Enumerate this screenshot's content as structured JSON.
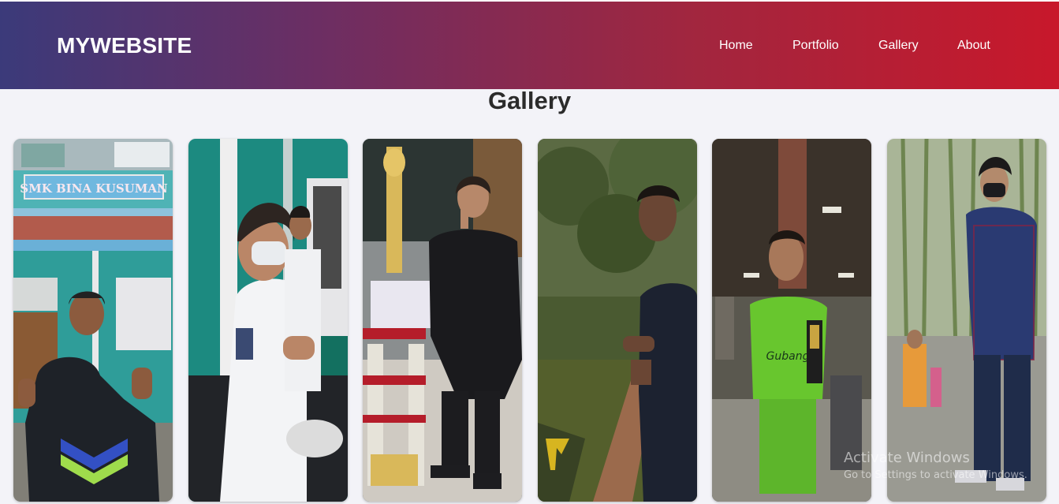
{
  "header": {
    "brand": "MYWEBSITE",
    "nav": [
      "Home",
      "Portfolio",
      "Gallery",
      "About"
    ]
  },
  "page": {
    "title": "Gallery"
  },
  "gallery": {
    "photos": [
      {
        "subject": "student-at-school-building",
        "sign": "SMK BINA KUSUMAN"
      },
      {
        "subject": "students-in-masks"
      },
      {
        "subject": "student-with-trophies"
      },
      {
        "subject": "person-in-garden"
      },
      {
        "subject": "player-with-award",
        "jersey": "Gubang"
      },
      {
        "subject": "person-in-bamboo-forest"
      }
    ]
  },
  "watermark": {
    "line1": "Activate Windows",
    "line2": "Go to Settings to activate Windows."
  },
  "colors": {
    "header_gradient": [
      "#3b3a7a",
      "#6c2e63",
      "#a1263f",
      "#c8182b"
    ],
    "page_bg": "#f3f3f8",
    "title_text": "#2b2b2b"
  }
}
